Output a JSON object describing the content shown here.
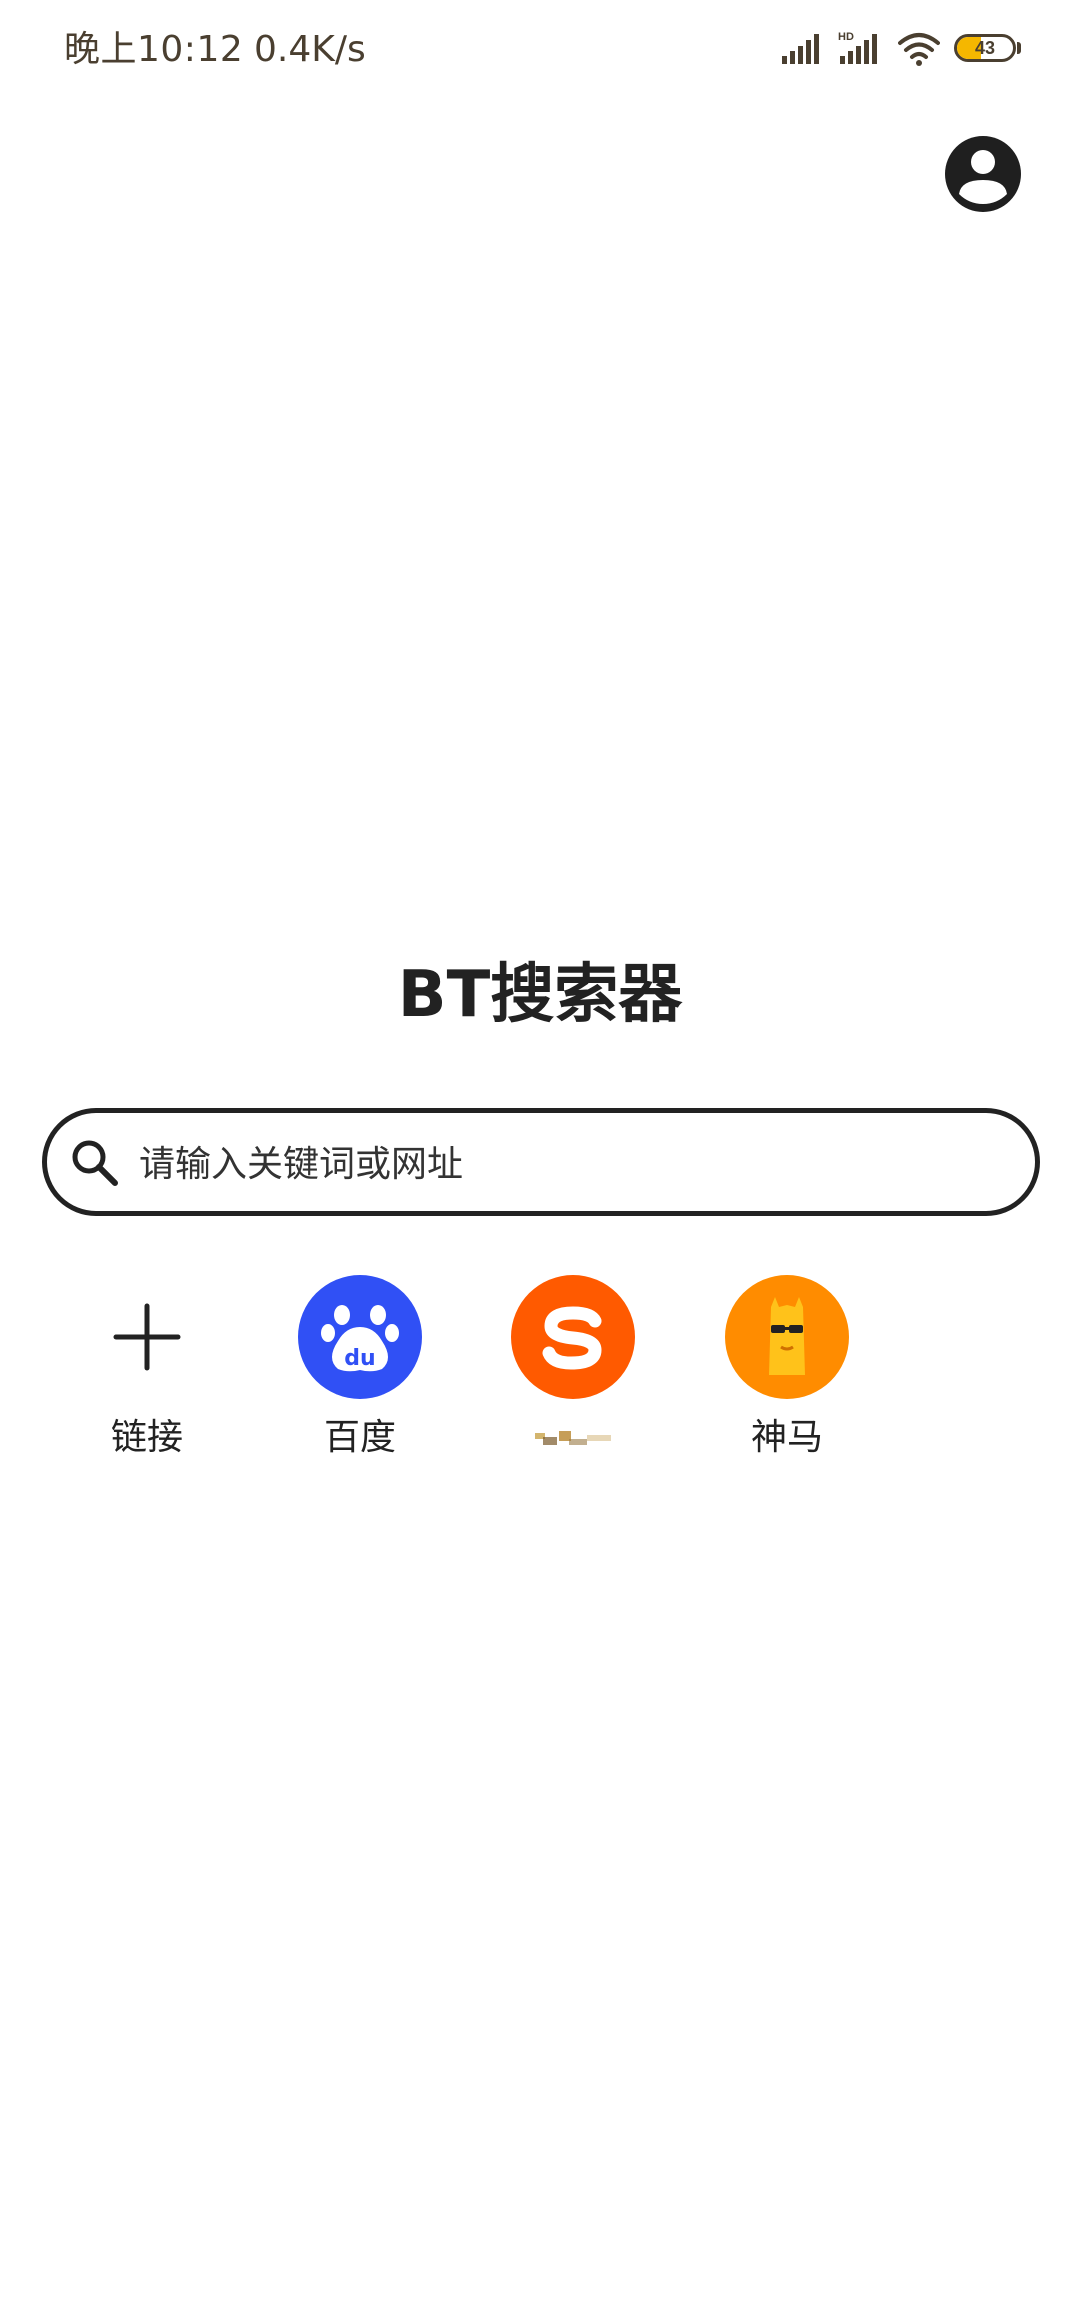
{
  "status_bar": {
    "time": "晚上10:12",
    "network_speed": "0.4K/s",
    "signal_label": "HD",
    "battery_level": "43",
    "battery_percent": 43,
    "battery_color": "#f5b700"
  },
  "header": {
    "account_icon": "account-circle-icon"
  },
  "main": {
    "title": "BT搜索器"
  },
  "search": {
    "icon": "search-icon",
    "placeholder": "请输入关键词或网址",
    "value": ""
  },
  "shortcuts": [
    {
      "label": "链接",
      "icon": "plus-icon"
    },
    {
      "label": "百度",
      "icon": "baidu-paw-icon",
      "color": "#3050f5"
    },
    {
      "label": "",
      "icon": "sogou-icon",
      "color": "#ff5a00"
    },
    {
      "label": "神马",
      "icon": "shenma-alpaca-icon",
      "color": "#ff8c00"
    }
  ]
}
